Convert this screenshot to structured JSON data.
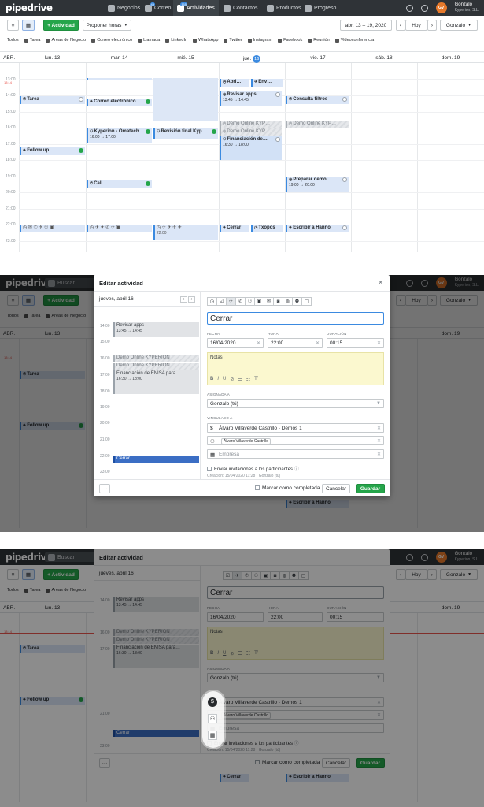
{
  "app": {
    "logo": "pipedrive"
  },
  "nav": {
    "deals": "Negocios",
    "mail": "Correo",
    "mail_badge": "49",
    "activities": "Actividades",
    "activities_badge": "165",
    "contacts": "Contactos",
    "products": "Productos",
    "progress": "Progreso",
    "search_placeholder": "Buscar"
  },
  "user": {
    "initials": "GV",
    "name": "Gonzalo",
    "company": "Kyperion, S.L."
  },
  "toolbar": {
    "add_activity": "+ Actividad",
    "propose_times": "Proponer horas",
    "date_range": "abr. 13 – 19, 2020",
    "prev": "‹",
    "next": "›",
    "today": "Hoy",
    "owner": "Gonzalo"
  },
  "filters": [
    "Todos",
    "Tarea",
    "Areas de Negocio",
    "Correo electrónico",
    "Llamada",
    "LinkedIn",
    "WhatsApp",
    "Twitter",
    "Instagram",
    "Facebook",
    "Reunión",
    "Videoconferencia"
  ],
  "calendar": {
    "corner": "ABR.",
    "days": [
      "lun. 13",
      "mar. 14",
      "mié. 15",
      "jue.",
      "vie. 17",
      "sáb. 18",
      "dom. 19"
    ],
    "today_num": "16",
    "now_label": "13:14",
    "hours": [
      "13:00",
      "14:00",
      "15:00",
      "16:00",
      "17:00",
      "18:00",
      "19:00",
      "20:00",
      "21:00",
      "22:00",
      "23:00"
    ],
    "events": {
      "tarea": "Tarea",
      "correo": "Correo electrónico",
      "abri": "Abri…",
      "env": "Env…",
      "revisar": "Revisar apps",
      "revisar_time": "13:45 → 14:45",
      "consulta": "Consulta filtros",
      "kyperion": "Kyperion - Omatech",
      "kyperion_time": "16:00 → 17:00",
      "revision": "Revisión final Kyp…",
      "demo1": "Demo Online KYP…",
      "demo2": "Demo Online KYP…",
      "demo3": "Demo Online KYP…",
      "financiacion": "Financiación de…",
      "financiacion_time": "16:30 → 18:00",
      "follow": "Follow up",
      "call": "Call",
      "preparar": "Preparar demo",
      "preparar_time": "19:00 → 20:00",
      "wed_time": "22:00",
      "cerrar": "Cerrar",
      "txopos": "Txopos",
      "escribir": "Escribir a Hanno"
    }
  },
  "modal": {
    "title": "Editar actividad",
    "day_label": "jueves, abril 16",
    "hours": [
      "14:00",
      "15:00",
      "16:00",
      "17:00",
      "18:00",
      "19:00",
      "20:00",
      "21:00",
      "22:00",
      "23:00"
    ],
    "events": {
      "revisar": "Revisar apps",
      "revisar_time": "13:45 → 14:45",
      "demo1": "Demo Online KYPERION",
      "demo2": "Demo Online KYPERION",
      "financiacion": "Financiación de ENISA para…",
      "financiacion_time": "16:30 → 18:00",
      "cerrar": "Cerrar"
    },
    "subject": "Cerrar",
    "labels": {
      "fecha": "FECHA",
      "hora": "HORA",
      "duracion": "DURACIÓN",
      "asignada": "ASIGNADA A",
      "vinculado": "VINCULADO A"
    },
    "fecha": "16/04/2020",
    "hora": "22:00",
    "duracion": "00:15",
    "notes_placeholder": "Notas",
    "assigned": "Gonzalo (tú)",
    "deal": "Álvaro Villaverde Castrillo - Demos 1",
    "person_chip": "Álvaro Villaverde Castrillo",
    "org_placeholder": "Empresa",
    "invite": "Enviar invitaciones a los participantes",
    "created": "Creación: 15/04/2020 11:28 · Gonzalo (tú)",
    "more": "···",
    "mark_done": "Marcar como completada",
    "cancel": "Cancelar",
    "save": "Guardar"
  },
  "colors": {
    "brand_green": "#25a54a",
    "accent_blue": "#3b8ae0",
    "topbar": "#2f3337",
    "now_line": "#e9554d"
  }
}
